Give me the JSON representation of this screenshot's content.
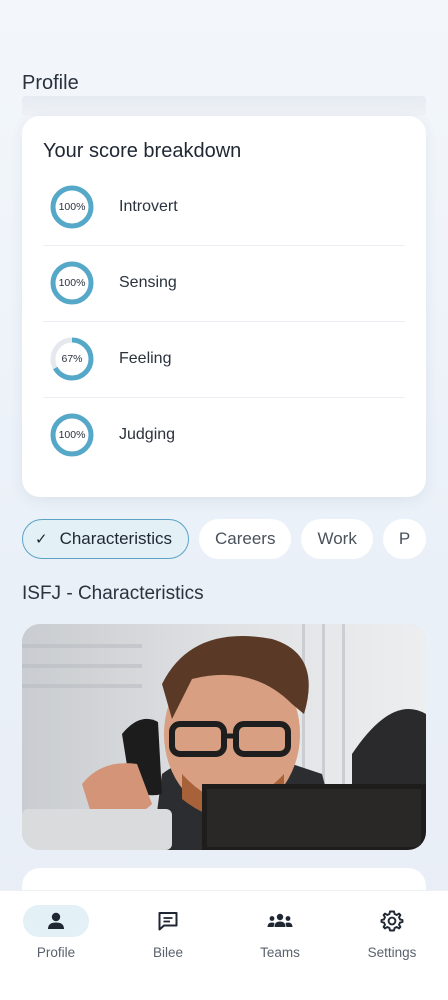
{
  "header": {
    "title": "Profile"
  },
  "score_card": {
    "title": "Your score breakdown",
    "items": [
      {
        "label": "Introvert",
        "percent_label": "100%",
        "value": 100
      },
      {
        "label": "Sensing",
        "percent_label": "100%",
        "value": 100
      },
      {
        "label": "Feeling",
        "percent_label": "67%",
        "value": 67
      },
      {
        "label": "Judging",
        "percent_label": "100%",
        "value": 100
      }
    ],
    "ring_color": "#55a8c8",
    "ring_track_color": "#e5e8ec"
  },
  "tabs": [
    {
      "label": "Characteristics",
      "active": true
    },
    {
      "label": "Careers",
      "active": false
    },
    {
      "label": "Work",
      "active": false
    },
    {
      "label": "P",
      "active": false
    }
  ],
  "section": {
    "title": "ISFJ - Characteristics"
  },
  "nav": {
    "items": [
      {
        "label": "Profile",
        "icon": "person-icon",
        "active": true
      },
      {
        "label": "Bilee",
        "icon": "chat-icon",
        "active": false
      },
      {
        "label": "Teams",
        "icon": "group-icon",
        "active": false
      },
      {
        "label": "Settings",
        "icon": "gear-icon",
        "active": false
      }
    ]
  },
  "colors": {
    "accent": "#55a8c8",
    "active_tab_bg": "#e3f0f6"
  }
}
